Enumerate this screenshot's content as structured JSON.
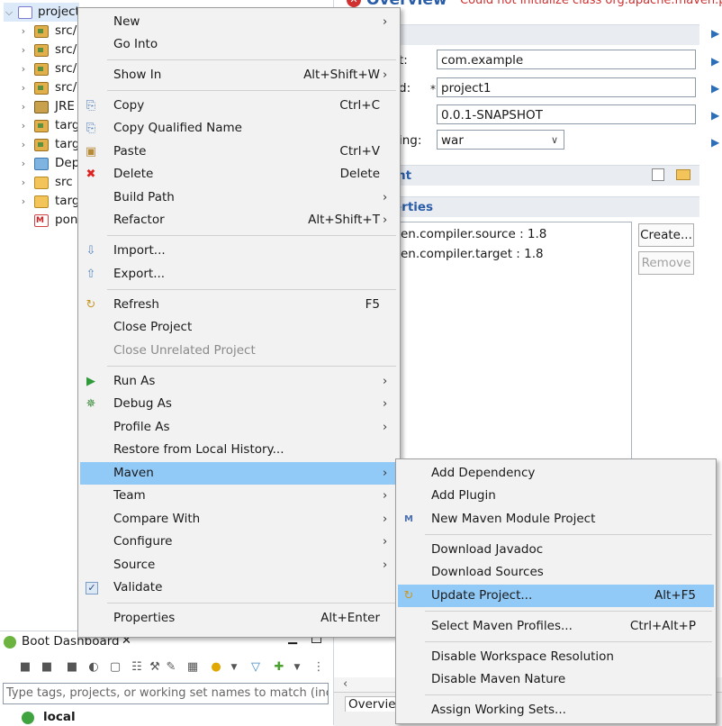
{
  "project_explorer": {
    "items": [
      {
        "label": "project",
        "icon": "maven-project-icon"
      },
      {
        "label": "src/",
        "icon": "package-folder-icon"
      },
      {
        "label": "src/",
        "icon": "package-folder-icon"
      },
      {
        "label": "src/",
        "icon": "package-folder-icon"
      },
      {
        "label": "src/",
        "icon": "package-folder-icon"
      },
      {
        "label": "JRE",
        "icon": "library-icon"
      },
      {
        "label": "targ",
        "icon": "package-folder-icon"
      },
      {
        "label": "targ",
        "icon": "package-folder-icon"
      },
      {
        "label": "Dep",
        "icon": "dependencies-icon"
      },
      {
        "label": "src",
        "icon": "folder-icon"
      },
      {
        "label": "targ",
        "icon": "folder-icon"
      },
      {
        "label": "pon",
        "icon": "pom-file-icon"
      }
    ]
  },
  "editor": {
    "title": "Overview",
    "error": "Could not initialize class org.apache.maven.plu",
    "fields": [
      {
        "label": "t:",
        "value": "com.example"
      },
      {
        "label": "d:",
        "value": "project1",
        "required": "*"
      },
      {
        "label": "",
        "value": "0.0.1-SNAPSHOT"
      },
      {
        "label": "ing:",
        "value": "war"
      }
    ],
    "section_parent": "nt",
    "section_properties": "erties",
    "properties": [
      "ven.compiler.source : 1.8",
      "ven.compiler.target : 1.8"
    ],
    "create_label": "Create...",
    "remove_label": "Remove",
    "bottom_tab": "Overview"
  },
  "context_menu": {
    "items": [
      {
        "label": "New",
        "shortcut": "",
        "submenu": true
      },
      {
        "label": "Go Into",
        "shortcut": "",
        "submenu": false
      },
      {
        "label": "Show In",
        "shortcut": "Alt+Shift+W",
        "submenu": true
      },
      {
        "label": "Copy",
        "shortcut": "Ctrl+C",
        "submenu": false,
        "icon": "copy-icon"
      },
      {
        "label": "Copy Qualified Name",
        "shortcut": "",
        "submenu": false,
        "icon": "copy-qualified-icon"
      },
      {
        "label": "Paste",
        "shortcut": "Ctrl+V",
        "submenu": false,
        "icon": "paste-icon"
      },
      {
        "label": "Delete",
        "shortcut": "Delete",
        "submenu": false,
        "icon": "delete-icon"
      },
      {
        "label": "Build Path",
        "shortcut": "",
        "submenu": true
      },
      {
        "label": "Refactor",
        "shortcut": "Alt+Shift+T",
        "submenu": true
      },
      {
        "label": "Import...",
        "shortcut": "",
        "submenu": false,
        "icon": "import-icon"
      },
      {
        "label": "Export...",
        "shortcut": "",
        "submenu": false,
        "icon": "export-icon"
      },
      {
        "label": "Refresh",
        "shortcut": "F5",
        "submenu": false,
        "icon": "refresh-icon"
      },
      {
        "label": "Close Project",
        "shortcut": "",
        "submenu": false
      },
      {
        "label": "Close Unrelated Project",
        "shortcut": "",
        "submenu": false,
        "disabled": true
      },
      {
        "label": "Run As",
        "shortcut": "",
        "submenu": true,
        "icon": "run-icon"
      },
      {
        "label": "Debug As",
        "shortcut": "",
        "submenu": true,
        "icon": "debug-icon"
      },
      {
        "label": "Profile As",
        "shortcut": "",
        "submenu": true
      },
      {
        "label": "Restore from Local History...",
        "shortcut": "",
        "submenu": false
      },
      {
        "label": "Maven",
        "shortcut": "",
        "submenu": true,
        "highlighted": true
      },
      {
        "label": "Team",
        "shortcut": "",
        "submenu": true
      },
      {
        "label": "Compare With",
        "shortcut": "",
        "submenu": true
      },
      {
        "label": "Configure",
        "shortcut": "",
        "submenu": true
      },
      {
        "label": "Source",
        "shortcut": "",
        "submenu": true
      },
      {
        "label": "Validate",
        "shortcut": "",
        "submenu": false,
        "icon": "checkbox-checked-icon"
      },
      {
        "label": "Properties",
        "shortcut": "Alt+Enter",
        "submenu": false
      }
    ]
  },
  "maven_submenu": {
    "items": [
      {
        "label": "Add Dependency",
        "shortcut": ""
      },
      {
        "label": "Add Plugin",
        "shortcut": ""
      },
      {
        "label": "New Maven Module Project",
        "shortcut": "",
        "icon": "maven-module-icon"
      },
      {
        "label": "Download Javadoc",
        "shortcut": ""
      },
      {
        "label": "Download Sources",
        "shortcut": ""
      },
      {
        "label": "Update Project...",
        "shortcut": "Alt+F5",
        "icon": "update-project-icon",
        "highlighted": true
      },
      {
        "label": "Select Maven Profiles...",
        "shortcut": "Ctrl+Alt+P"
      },
      {
        "label": "Disable Workspace Resolution",
        "shortcut": ""
      },
      {
        "label": "Disable Maven Nature",
        "shortcut": ""
      },
      {
        "label": "Assign Working Sets...",
        "shortcut": ""
      }
    ]
  },
  "boot_dashboard": {
    "title": "Boot Dashboard",
    "filter_placeholder": "Type tags, projects, or working set names to match (incl.",
    "local_label": "local"
  },
  "colors": {
    "highlight": "#91c9f7",
    "menu_bg": "#f2f2f2",
    "error": "#d03030",
    "section_title": "#2a5da8"
  }
}
